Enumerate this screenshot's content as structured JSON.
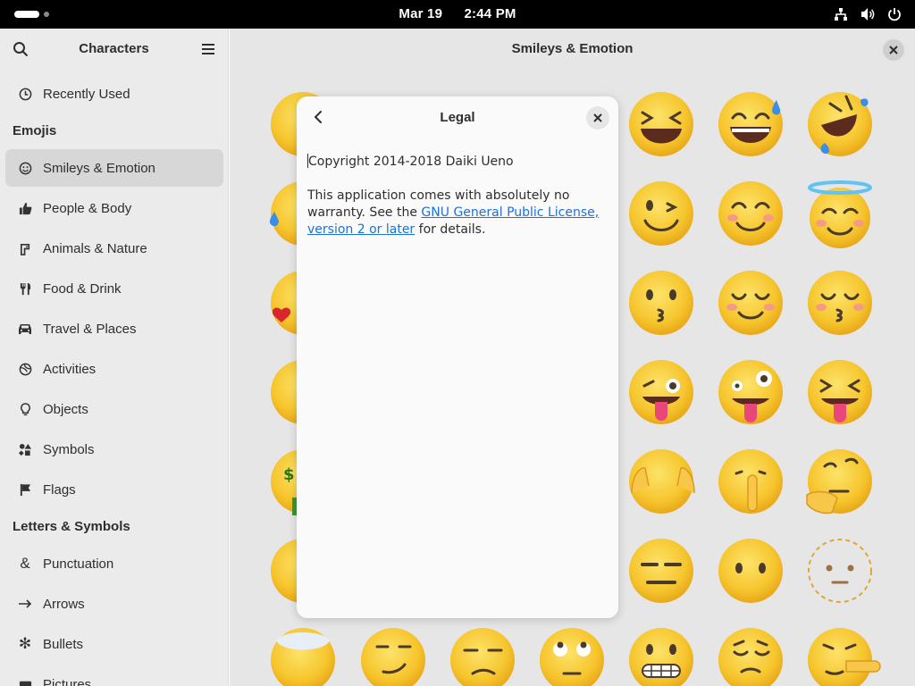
{
  "topbar": {
    "date": "Mar 19",
    "time": "2:44 PM",
    "icons": [
      "network-icon",
      "volume-icon",
      "power-icon"
    ]
  },
  "sidebar": {
    "title": "Characters",
    "recently_used": "Recently Used",
    "emojis_header": "Emojis",
    "emoji_items": [
      {
        "label": "Smileys & Emotion",
        "icon": "smiley-icon",
        "active": true
      },
      {
        "label": "People & Body",
        "icon": "thumbs-up-icon"
      },
      {
        "label": "Animals & Nature",
        "icon": "animals-icon"
      },
      {
        "label": "Food & Drink",
        "icon": "food-icon"
      },
      {
        "label": "Travel & Places",
        "icon": "car-icon"
      },
      {
        "label": "Activities",
        "icon": "activities-icon"
      },
      {
        "label": "Objects",
        "icon": "lightbulb-icon"
      },
      {
        "label": "Symbols",
        "icon": "symbols-icon"
      },
      {
        "label": "Flags",
        "icon": "flag-icon"
      }
    ],
    "letters_header": "Letters & Symbols",
    "letter_items": [
      {
        "label": "Punctuation",
        "icon": "ampersand-icon"
      },
      {
        "label": "Arrows",
        "icon": "arrow-icon"
      },
      {
        "label": "Bullets",
        "icon": "bullet-icon"
      },
      {
        "label": "Pictures",
        "icon": "pictures-icon"
      }
    ]
  },
  "main": {
    "title": "Smileys & Emotion"
  },
  "dialog": {
    "title": "Legal",
    "copyright": "Copyright 2014-2018 Daiki Ueno",
    "warranty_prefix": "This application comes with absolutely no warranty. See the ",
    "license_link": "GNU General Public License, version 2 or later",
    "warranty_suffix": " for details."
  },
  "colors": {
    "accent": "#1c71d8",
    "sidebar_bg": "#ebebeb",
    "active_row": "#d7d7d7",
    "emoji_yellow": "#f6c52d"
  }
}
